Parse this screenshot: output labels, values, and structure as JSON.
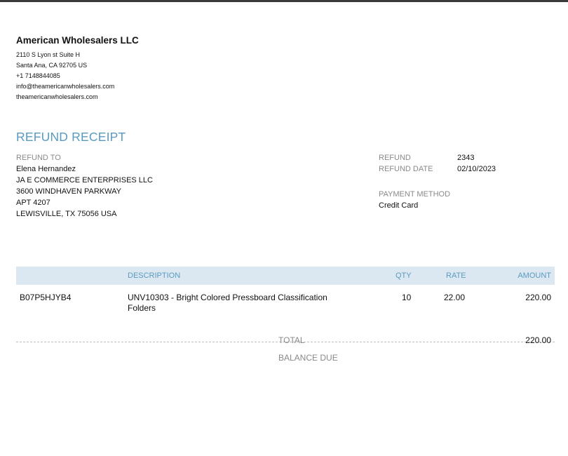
{
  "company": {
    "name": "American Wholesalers LLC",
    "address1": "2110 S Lyon st Suite H",
    "address2": "Santa Ana, CA  92705 US",
    "phone": "+1 7148844085",
    "email": "info@theamericanwholesalers.com",
    "website": "theamericanwholesalers.com"
  },
  "title": "REFUND RECEIPT",
  "refund_to": {
    "label": "REFUND TO",
    "name": "Elena Hernandez",
    "company": "JA E COMMERCE ENTERPRISES LLC",
    "street": "3600 WINDHAVEN PARKWAY",
    "apt": "APT 4207",
    "city": "LEWISVILLE, TX  75056 USA"
  },
  "meta": {
    "refund_label": "REFUND",
    "refund_value": "2343",
    "date_label": "REFUND DATE",
    "date_value": "02/10/2023",
    "payment_label": "PAYMENT METHOD",
    "payment_value": "Credit Card"
  },
  "table": {
    "headers": {
      "description": "DESCRIPTION",
      "qty": "QTY",
      "rate": "RATE",
      "amount": "AMOUNT"
    },
    "rows": [
      {
        "sku": "B07P5HJYB4",
        "description_line1": "UNV10303 - Bright Colored Pressboard Classification",
        "description_line2": "Folders",
        "qty": "10",
        "rate": "22.00",
        "amount": "220.00"
      }
    ]
  },
  "totals": {
    "total_label": "TOTAL",
    "total_value": "220.00",
    "balance_label": "BALANCE DUE"
  },
  "colors": {
    "accent": "#5a9ac0",
    "header_bg": "#dce8f1",
    "label_gray": "#8a8a8a"
  }
}
